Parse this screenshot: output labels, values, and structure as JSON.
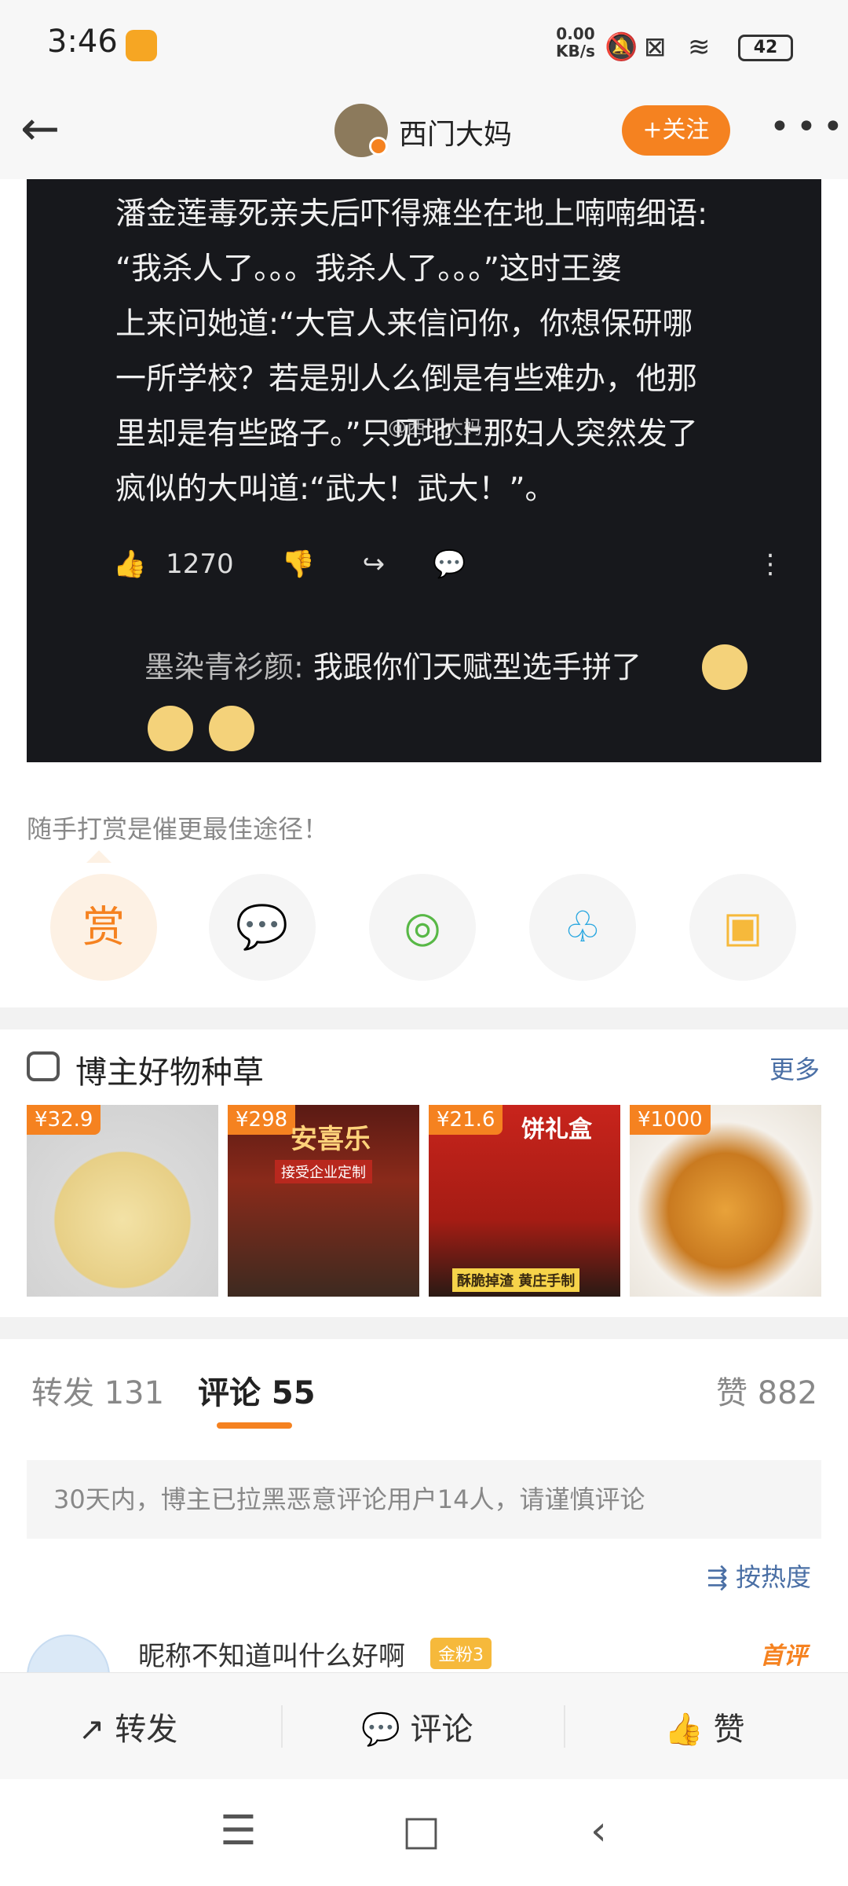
{
  "status_bar": {
    "time": "3:46",
    "net_speed_value": "0.00",
    "net_speed_unit": "KB/s",
    "battery": "42",
    "icons": [
      "weibo-app-icon",
      "mute-icon",
      "no-sim-icon",
      "wifi-icon",
      "battery-icon"
    ]
  },
  "header": {
    "back_icon": "back-arrow-icon",
    "username": "西门大妈",
    "follow_label": "+关注",
    "more_icon": "more-dots-icon"
  },
  "post_image": {
    "lines": [
      "潘金莲毒死亲夫后吓得瘫坐在地上喃喃细语:",
      "“我杀人了。。。我杀人了。。。”这时王婆",
      "上来问她道:“大官人来信问你，你想保研哪",
      "一所学校？若是别人么倒是有些难办，他那",
      "里却是有些路子。”只见地上那妇人突然发了",
      "疯似的大叫道:“武大！武大！”。"
    ],
    "watermark": "@西门大妈",
    "like_count": "1270",
    "comment_author": "墨染青衫颜",
    "comment_text": "我跟你们天赋型选手拼了"
  },
  "reward": {
    "tip_text": "随手打赏是催更最佳途径！",
    "reward_label": "赏",
    "share_icons": [
      "wechat-icon",
      "moments-icon",
      "qq-icon",
      "save-image-icon"
    ]
  },
  "goods": {
    "title": "博主好物种草",
    "more_label": "更多",
    "items": [
      {
        "price": "¥32.9"
      },
      {
        "price": "¥298"
      },
      {
        "price": "¥21.6"
      },
      {
        "price": "¥1000"
      }
    ],
    "item1_banner": "安喜乐",
    "item1_tag": "接受企业定制",
    "item2_banner": "饼礼盒",
    "item2_tag": "酥脆掉渣 黄庄手制"
  },
  "tabs": {
    "repost": "转发 131",
    "comment": "评论 55",
    "like": "赞 882"
  },
  "notice": "30天内，博主已拉黑恶意评论用户14人，请谨慎评论",
  "sort_label": "按热度",
  "first_comment": {
    "name": "昵称不知道叫什么好啊",
    "badge": "金粉3",
    "tag": "首评"
  },
  "bottom_bar": {
    "repost": "转发",
    "comment": "评论",
    "like": "赞"
  },
  "colors": {
    "accent": "#f58220",
    "link": "#4a6fa5",
    "meme_bg": "#17181c"
  }
}
